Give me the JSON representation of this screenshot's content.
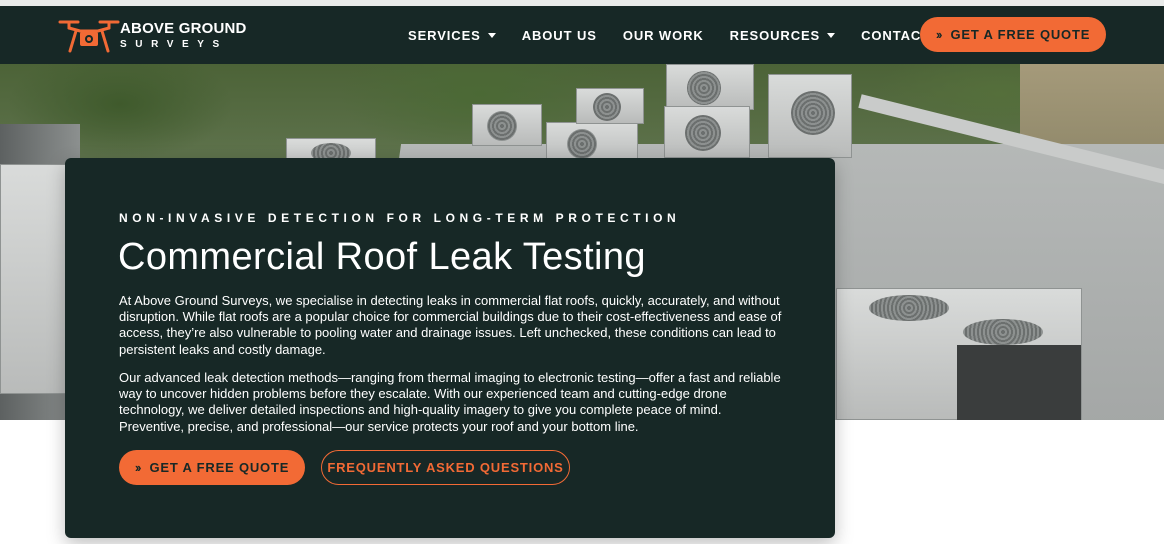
{
  "brand": {
    "name_line1": "ABOVE GROUND",
    "name_line2": "SURVEYS",
    "logo_icon": "drone-camera-icon",
    "accent_color": "#f26a35",
    "dark_color": "#172826"
  },
  "nav": {
    "items": [
      {
        "label": "SERVICES",
        "has_dropdown": true
      },
      {
        "label": "ABOUT US",
        "has_dropdown": false
      },
      {
        "label": "OUR WORK",
        "has_dropdown": false
      },
      {
        "label": "RESOURCES",
        "has_dropdown": true
      },
      {
        "label": "CONTACT",
        "has_dropdown": false
      }
    ],
    "cta_label": "GET A FREE QUOTE",
    "cta_icon": "double-chevron-right-icon"
  },
  "hero": {
    "eyebrow": "NON-INVASIVE DETECTION FOR LONG-TERM PROTECTION",
    "title": "Commercial Roof Leak Testing",
    "paragraph1": "At Above Ground Surveys, we specialise in detecting leaks in commercial flat roofs, quickly, accurately, and without disruption. While flat roofs are a popular choice for commercial buildings due to their cost-effectiveness and ease of access, they’re also vulnerable to pooling water and drainage issues. Left unchecked, these conditions can lead to persistent leaks and costly damage.",
    "paragraph2": "Our advanced leak detection methods—ranging from thermal imaging to electronic testing—offer a fast and reliable way to uncover hidden problems before they escalate. With our experienced team and cutting-edge drone technology, we deliver detailed inspections and high-quality imagery to give you complete peace of mind. Preventive, precise, and professional—our service protects your roof and your bottom line.",
    "primary_button": "GET A FREE QUOTE",
    "secondary_button": "FREQUENTLY ASKED QUESTIONS",
    "background_image": "rooftop-hvac-units-photo"
  }
}
